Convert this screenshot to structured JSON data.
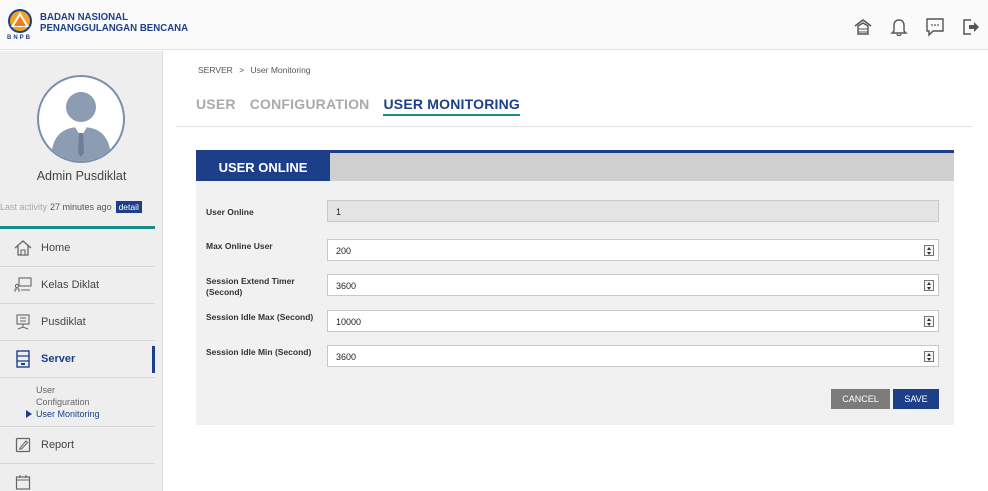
{
  "brand": {
    "line1": "BADAN NASIONAL",
    "line2": "PENANGGULANGAN BENCANA",
    "abbr": "BNPB",
    "primary_color": "#1d3f8a",
    "accent_color": "#1b8c8c"
  },
  "header_icons": [
    "home-icon",
    "bell-icon",
    "message-icon",
    "logout-icon"
  ],
  "sidebar": {
    "user_name": "Admin Pusdiklat",
    "last_activity_label": "Last activity",
    "last_activity_value": "27 minutes ago",
    "detail_label": "detail",
    "items": [
      {
        "label": "Home",
        "icon": "home-icon"
      },
      {
        "label": "Kelas Diklat",
        "icon": "classroom-icon"
      },
      {
        "label": "Pusdiklat",
        "icon": "building-icon"
      },
      {
        "label": "Server",
        "icon": "server-icon",
        "active": true
      },
      {
        "label": "Report",
        "icon": "report-icon"
      }
    ],
    "submenu": [
      "User",
      "Configuration",
      "User Monitoring"
    ]
  },
  "breadcrumb": {
    "root": "SERVER",
    "sep": ">",
    "current": "User Monitoring"
  },
  "tabs": [
    {
      "label": "USER"
    },
    {
      "label": "CONFIGURATION"
    },
    {
      "label": "USER MONITORING",
      "active": true
    }
  ],
  "panel": {
    "title": "USER ONLINE",
    "fields": [
      {
        "label": "User Online",
        "value": "1",
        "readonly": true
      },
      {
        "label": "Max Online User",
        "value": "200"
      },
      {
        "label": "Session Extend Timer (Second)",
        "value": "3600"
      },
      {
        "label": "Session Idle Max (Second)",
        "value": "10000"
      },
      {
        "label": "Session Idle Min (Second)",
        "value": "3600"
      }
    ],
    "cancel_label": "CANCEL",
    "save_label": "SAVE"
  }
}
